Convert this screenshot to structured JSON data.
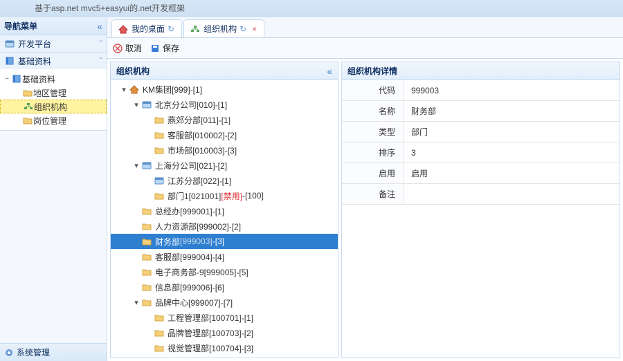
{
  "header": {
    "subtitle": "基于asp.net mvc5+easyui的.net开发框架"
  },
  "nav": {
    "title": "导航菜单",
    "sections": [
      {
        "label": "开发平台",
        "expanded": false
      },
      {
        "label": "基础资料",
        "expanded": true
      }
    ],
    "tree": {
      "root": "基础资料",
      "children": [
        {
          "label": "地区管理"
        },
        {
          "label": "组织机构"
        },
        {
          "label": "岗位管理"
        }
      ]
    },
    "footer": "系统管理"
  },
  "tabs": [
    {
      "label": "我的桌面",
      "kind": "home"
    },
    {
      "label": "组织机构",
      "kind": "org"
    }
  ],
  "toolbar": {
    "cancel": "取消",
    "save": "保存"
  },
  "treePanel": {
    "title": "组织机构"
  },
  "tree": [
    {
      "d": 0,
      "icon": "home",
      "toggle": "▾",
      "label": "KM集团[999]-[1]"
    },
    {
      "d": 1,
      "icon": "app",
      "toggle": "▾",
      "label": "北京分公司[010]-[1]"
    },
    {
      "d": 2,
      "icon": "folder",
      "toggle": "",
      "label": "燕郊分部[011]-[1]"
    },
    {
      "d": 2,
      "icon": "folder",
      "toggle": "",
      "label": "客服部[010002]-[2]"
    },
    {
      "d": 2,
      "icon": "folder",
      "toggle": "",
      "label": "市场部[010003]-[3]"
    },
    {
      "d": 1,
      "icon": "app",
      "toggle": "▾",
      "label": "上海分公司[021]-[2]"
    },
    {
      "d": 2,
      "icon": "app",
      "toggle": "",
      "label": "江苏分部[022]-[1]"
    },
    {
      "d": 2,
      "icon": "folder",
      "toggle": "",
      "label": "部门1[021001]",
      "suffixRed": "[禁用]",
      "suffix2": "-[100]"
    },
    {
      "d": 1,
      "icon": "folder",
      "toggle": "",
      "label": "总经办[999001]-[1]"
    },
    {
      "d": 1,
      "icon": "folder",
      "toggle": "",
      "label": "人力资源部[999002]-[2]"
    },
    {
      "d": 1,
      "icon": "folder",
      "toggle": "",
      "label": "财务部",
      "suffixGray": "[999003]",
      "suffix2": "-[3]",
      "selected": true
    },
    {
      "d": 1,
      "icon": "folder",
      "toggle": "",
      "label": "客服部[999004]-[4]"
    },
    {
      "d": 1,
      "icon": "folder",
      "toggle": "",
      "label": "电子商务部-9[999005]-[5]"
    },
    {
      "d": 1,
      "icon": "folder",
      "toggle": "",
      "label": "信息部[999006]-[6]"
    },
    {
      "d": 1,
      "icon": "folder",
      "toggle": "▾",
      "label": "品牌中心[999007]-[7]"
    },
    {
      "d": 2,
      "icon": "folder",
      "toggle": "",
      "label": "工程管理部[100701]-[1]"
    },
    {
      "d": 2,
      "icon": "folder",
      "toggle": "",
      "label": "品牌管理部[100703]-[2]"
    },
    {
      "d": 2,
      "icon": "folder",
      "toggle": "",
      "label": "视觉管理部[100704]-[3]"
    }
  ],
  "detail": {
    "title": "组织机构详情",
    "fields": [
      {
        "label": "代码",
        "value": "999003"
      },
      {
        "label": "名称",
        "value": "财务部"
      },
      {
        "label": "类型",
        "value": "部门"
      },
      {
        "label": "排序",
        "value": "3"
      },
      {
        "label": "启用",
        "value": "启用"
      },
      {
        "label": "备注",
        "value": ""
      }
    ]
  }
}
